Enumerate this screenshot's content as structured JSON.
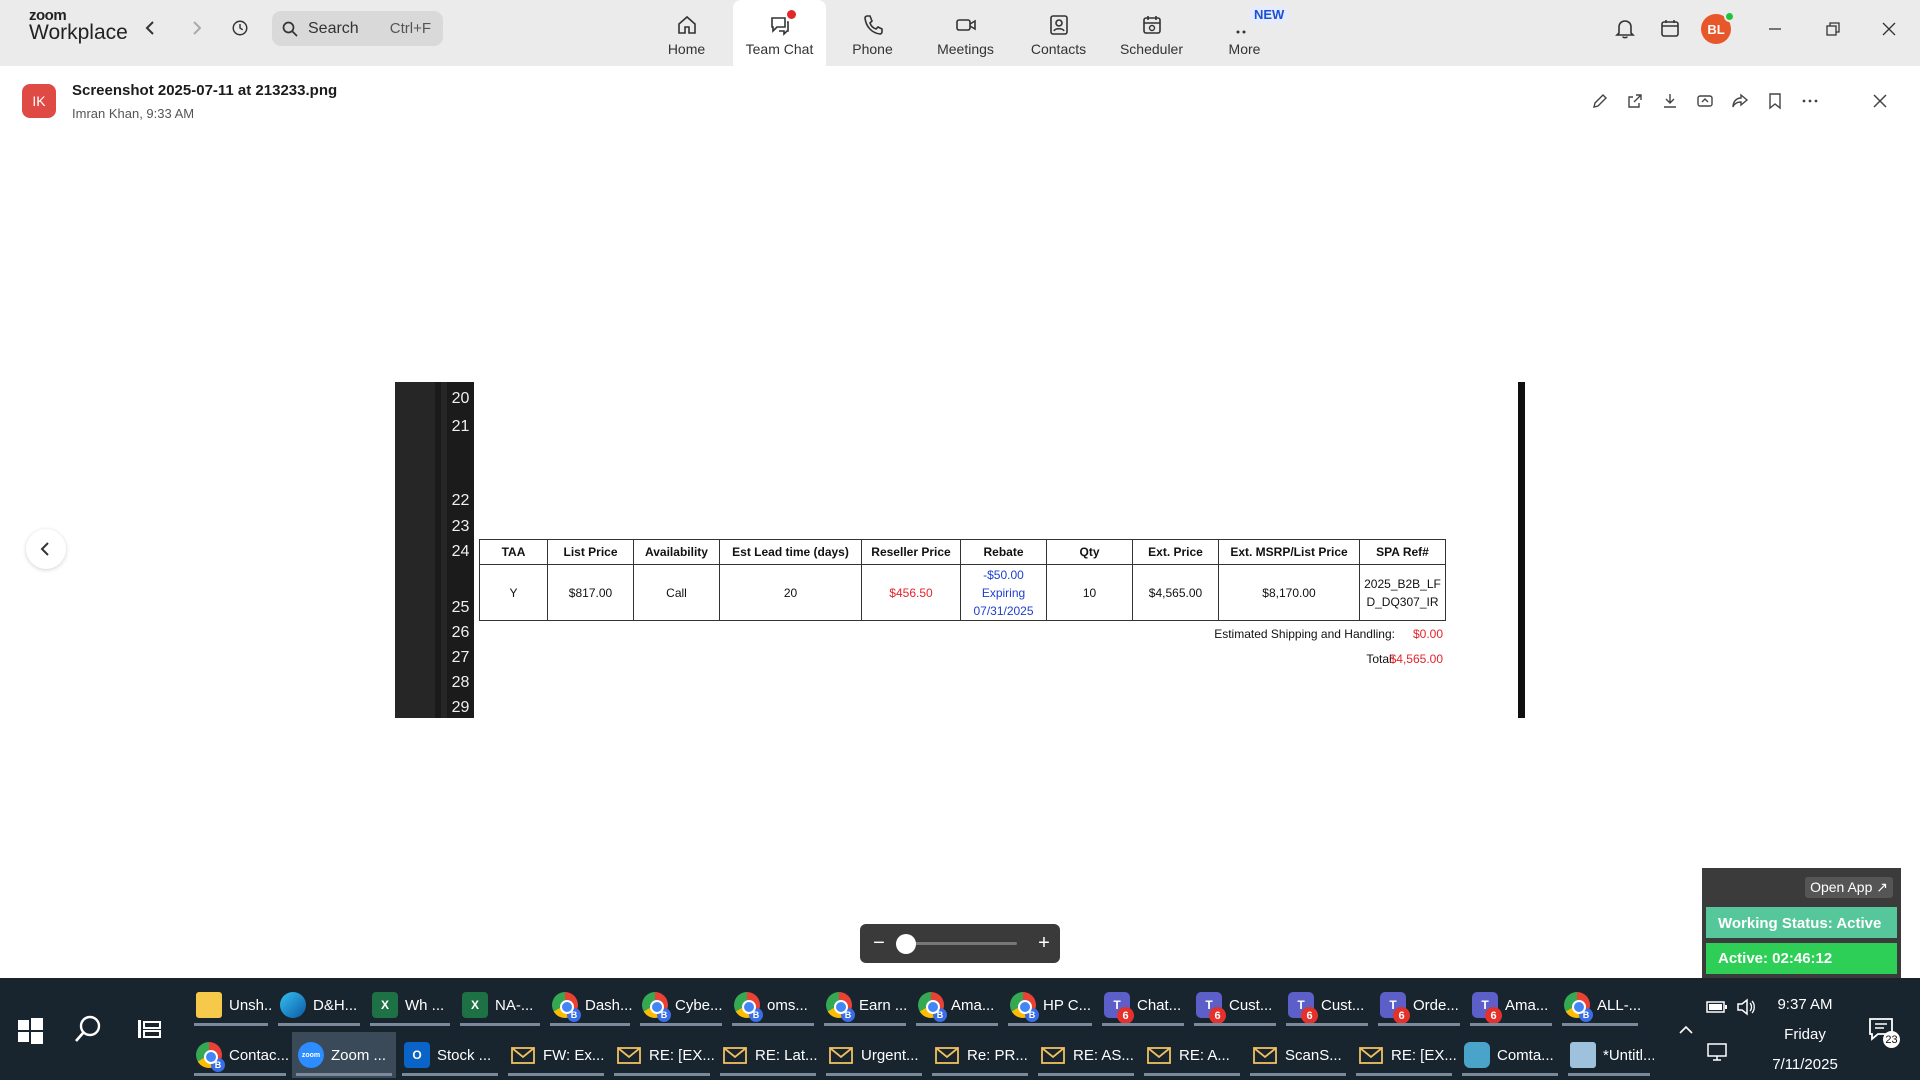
{
  "app": {
    "brand": "zoom",
    "product": "Workplace"
  },
  "search": {
    "placeholder": "Search",
    "shortcut": "Ctrl+F"
  },
  "tabs": [
    {
      "label": "Home",
      "icon": "home-icon"
    },
    {
      "label": "Team Chat",
      "icon": "chat-icon",
      "active": true,
      "has_dot": true
    },
    {
      "label": "Phone",
      "icon": "phone-icon"
    },
    {
      "label": "Meetings",
      "icon": "video-icon"
    },
    {
      "label": "Contacts",
      "icon": "contacts-icon"
    },
    {
      "label": "Scheduler",
      "icon": "calendar-icon"
    },
    {
      "label": "More",
      "icon": "more-icon",
      "badge": "NEW"
    }
  ],
  "user_avatar": {
    "initials": "BL",
    "color": "#e8572a",
    "status": "online"
  },
  "file": {
    "avatar_initials": "IK",
    "name": "Screenshot 2025-07-11 at 213233.png",
    "meta": "Imran Khan, 9:33 AM"
  },
  "file_actions": [
    "edit-icon",
    "open-external-icon",
    "download-icon",
    "share-screen-icon",
    "forward-icon",
    "bookmark-icon",
    "more-icon",
    "close-icon"
  ],
  "sheet": {
    "row_numbers": [
      "20",
      "21",
      "22",
      "23",
      "24",
      "25",
      "26",
      "27",
      "28",
      "29"
    ],
    "headers": [
      "TAA",
      "List Price",
      "Availability",
      "Est Lead time (days)",
      "Reseller Price",
      "Rebate",
      "Qty",
      "Ext. Price",
      "Ext. MSRP/List Price",
      "SPA Ref#"
    ],
    "row": {
      "taa": "Y",
      "list_price": "$817.00",
      "availability": "Call",
      "lead_time": "20",
      "reseller_price": "$456.50",
      "rebate_line1": "-$50.00",
      "rebate_line2": "Expiring",
      "rebate_line3": "07/31/2025",
      "qty": "10",
      "ext_price": "$4,565.00",
      "ext_msrp": "$8,170.00",
      "spa_line1": "2025_B2B_LF",
      "spa_line2": "D_DQ307_IR"
    },
    "shipping_label": "Estimated Shipping and Handling:",
    "shipping_value": "$0.00",
    "total_label": "Total:",
    "total_value": "$4,565.00"
  },
  "zoom_controls": {
    "minus": "−",
    "plus": "+",
    "level": 0.05
  },
  "widget": {
    "open_app": "Open App ↗",
    "working_status": "Working Status: Active",
    "active_timer": "Active: 02:46:12"
  },
  "taskbar": {
    "row1": [
      {
        "label": "Unsh...",
        "icon": "folder"
      },
      {
        "label": "D&H...",
        "icon": "edge"
      },
      {
        "label": "Wh ...",
        "icon": "excel"
      },
      {
        "label": "NA-...",
        "icon": "excel"
      },
      {
        "label": "Dash...",
        "icon": "chrome"
      },
      {
        "label": "Cybe...",
        "icon": "chrome"
      },
      {
        "label": "oms...",
        "icon": "chrome"
      },
      {
        "label": "Earn ...",
        "icon": "chrome"
      },
      {
        "label": "Ama...",
        "icon": "chrome"
      },
      {
        "label": "HP C...",
        "icon": "chrome"
      },
      {
        "label": "Chat...",
        "icon": "teams",
        "badge": "6"
      },
      {
        "label": "Cust...",
        "icon": "teams",
        "badge": "6"
      },
      {
        "label": "Cust...",
        "icon": "teams",
        "badge": "6"
      },
      {
        "label": "Orde...",
        "icon": "teams",
        "badge": "6"
      },
      {
        "label": "Ama...",
        "icon": "teams",
        "badge": "6"
      },
      {
        "label": "ALL-...",
        "icon": "chrome"
      }
    ],
    "row2": [
      {
        "label": "Contac...",
        "icon": "chrome"
      },
      {
        "label": "Zoom ...",
        "icon": "zoom",
        "active": true
      },
      {
        "label": "Stock ...",
        "icon": "outlook"
      },
      {
        "label": "FW: Ex...",
        "icon": "mail"
      },
      {
        "label": "RE: [EX...",
        "icon": "mail"
      },
      {
        "label": "RE: Lat...",
        "icon": "mail"
      },
      {
        "label": "Urgent...",
        "icon": "mail"
      },
      {
        "label": "Re: PR...",
        "icon": "mail"
      },
      {
        "label": "RE: AS...",
        "icon": "mail"
      },
      {
        "label": "RE: A...",
        "icon": "mail"
      },
      {
        "label": "ScanS...",
        "icon": "mail"
      },
      {
        "label": "RE: [EX...",
        "icon": "mail"
      },
      {
        "label": "Comta...",
        "icon": "generic"
      },
      {
        "label": "*Untitl...",
        "icon": "note"
      }
    ],
    "clock_time": "9:37 AM",
    "clock_day": "Friday",
    "clock_date": "7/11/2025",
    "notification_count": "23"
  }
}
